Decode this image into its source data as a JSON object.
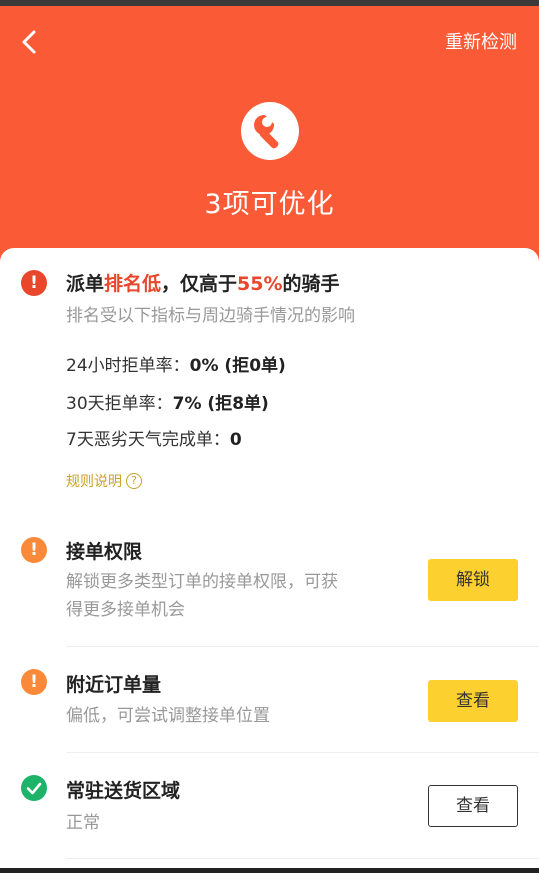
{
  "header": {
    "recheck_label": "重新检测",
    "title": "3项可优化",
    "bg_color": "#fb5a37"
  },
  "ranking": {
    "title_part1": "派单",
    "title_highlight1": "排名低",
    "title_part2": "，仅高于",
    "title_highlight2": "55%",
    "title_part3": "的骑手",
    "subtitle": "排名受以下指标与周边骑手情况的影响",
    "metrics": [
      {
        "label": "24小时拒单率：",
        "value": "0% (拒0单)"
      },
      {
        "label": "30天拒单率：",
        "value": "7% (拒8单)"
      },
      {
        "label": "7天恶劣天气完成单：",
        "value": "0"
      }
    ],
    "rules_label": "规则说明",
    "icon": "exclamation-icon",
    "icon_color": "#e8472b"
  },
  "permission": {
    "title": "接单权限",
    "desc_line1": "解锁更多类型订单的接单权限，可获",
    "desc_line2": "得更多接单机会",
    "button_label": "解锁",
    "icon": "exclamation-icon",
    "icon_color": "#fa8a3a"
  },
  "nearby": {
    "title": "附近订单量",
    "desc": "偏低，可尝试调整接单位置",
    "button_label": "查看",
    "icon": "exclamation-icon",
    "icon_color": "#fa8a3a"
  },
  "area": {
    "title": "常驻送货区域",
    "desc": "正常",
    "button_label": "查看",
    "icon": "check-icon",
    "icon_color": "#1db46a"
  },
  "colors": {
    "accent_yellow": "#fcd02f",
    "rules_gold": "#c9a228"
  }
}
